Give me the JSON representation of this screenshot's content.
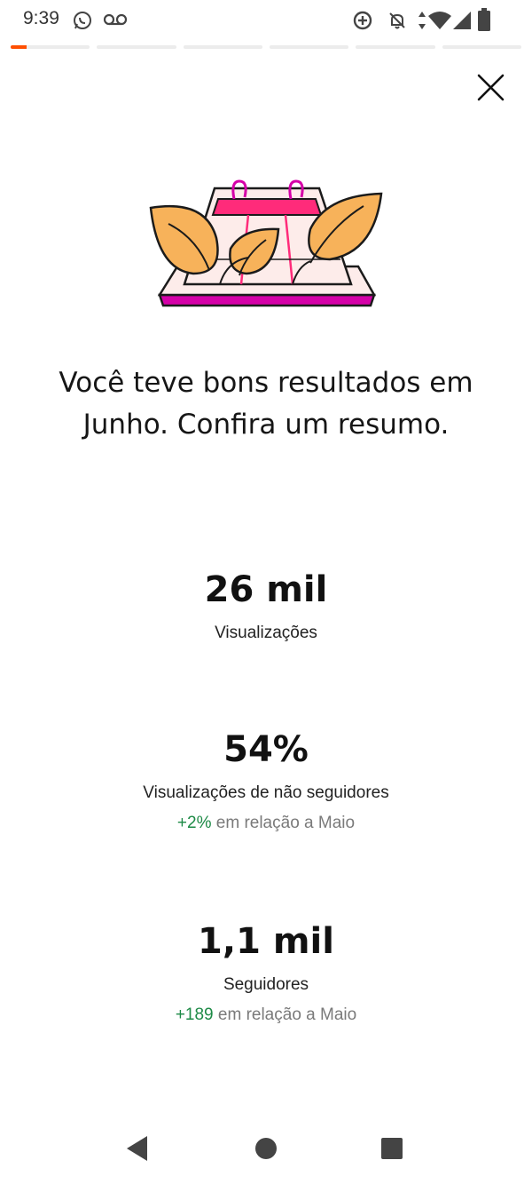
{
  "status_bar": {
    "time": "9:39",
    "icons": [
      "whatsapp-icon",
      "voicemail-icon",
      "data-saver-icon",
      "notifications-off-icon",
      "data-arrows-icon",
      "wifi-icon",
      "signal-icon",
      "battery-icon"
    ]
  },
  "progress": {
    "segments": 6,
    "current_segment": 1,
    "current_fill_fraction": 0.2,
    "accent_color": "#ff4f00"
  },
  "close_button": {
    "icon": "close-icon"
  },
  "illustration": {
    "icon": "calendar-leaves-illustration"
  },
  "headline": "Você teve bons resultados em Junho. Confira um resumo.",
  "stats": [
    {
      "value": "26 mil",
      "label": "Visualizações"
    },
    {
      "value": "54%",
      "label": "Visualizações de não seguidores",
      "delta": "+2%",
      "comparison": "em relação a Maio"
    },
    {
      "value": "1,1 mil",
      "label": "Seguidores",
      "delta": "+189",
      "comparison": "em relação a Maio"
    }
  ],
  "colors": {
    "positive_delta": "#1d8a46",
    "leaf_fill": "#f7b25a",
    "magenta": "#d500a8",
    "pink": "#ff2b7a"
  },
  "nav_bar": {
    "icons": [
      "back-icon",
      "home-icon",
      "recents-icon"
    ]
  }
}
